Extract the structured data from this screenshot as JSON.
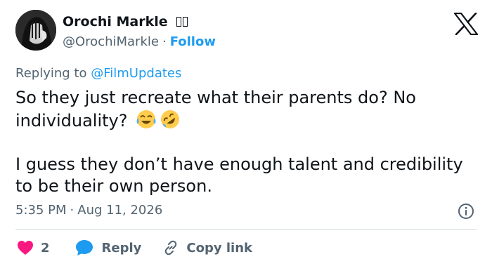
{
  "author": {
    "name": "Orochi Markle",
    "handle": "@OrochiMarkle",
    "separator": "·",
    "follow_label": "Follow"
  },
  "reply_context": {
    "prefix": "Replying to",
    "mention": "@FilmUpdates"
  },
  "tweet": {
    "paragraph1": "So they just recreate what their parents do? No individuality?",
    "emojis": [
      "joy-emoji",
      "rofl-emoji"
    ],
    "paragraph2": "I guess they don’t have enough talent and credibility to be their own person."
  },
  "meta": {
    "time": "5:35 PM",
    "separator": "·",
    "date": "Aug 11, 2026"
  },
  "actions": {
    "like_count": "2",
    "reply_label": "Reply",
    "copy_label": "Copy link"
  },
  "colors": {
    "accent": "#1d9bf0",
    "like": "#f91880",
    "secondary_text": "#536471",
    "primary_text": "#0f1419",
    "divider": "#cfd9de"
  },
  "icons": {
    "logo": "x-logo-icon",
    "info": "info-icon",
    "like": "heart-icon",
    "reply": "speech-bubble-icon",
    "copy": "link-icon"
  }
}
